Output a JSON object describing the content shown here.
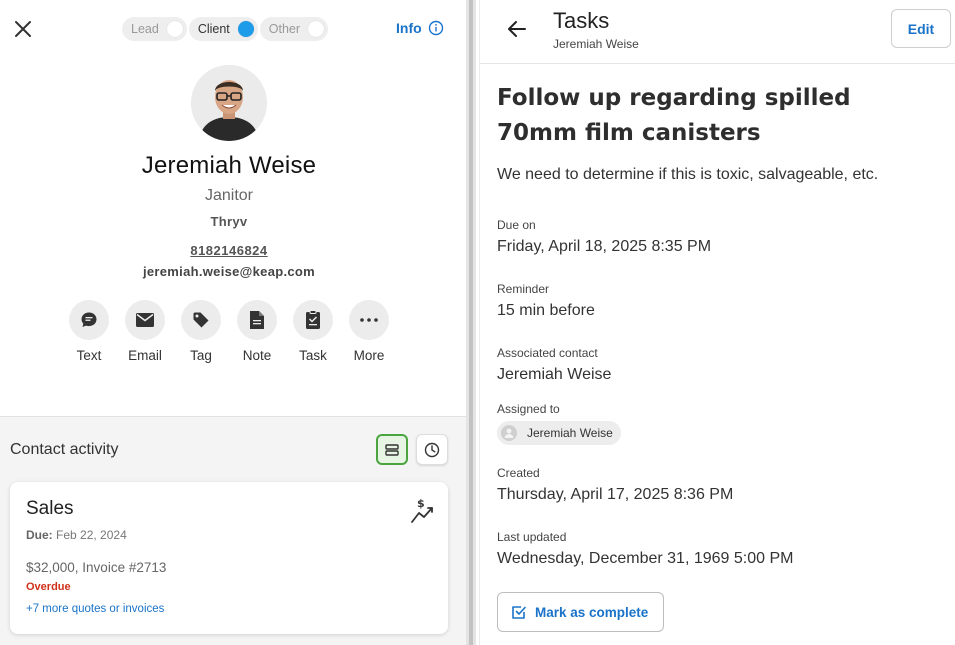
{
  "contact": {
    "stages": [
      {
        "label": "Lead",
        "active": false
      },
      {
        "label": "Client",
        "active": true
      },
      {
        "label": "Other",
        "active": false
      }
    ],
    "info_label": "Info",
    "name": "Jeremiah Weise",
    "job_title": "Janitor",
    "company": "Thryv",
    "phone": "8182146824",
    "email": "jeremiah.weise@keap.com",
    "actions": [
      {
        "label": "Text",
        "icon": "chat-icon"
      },
      {
        "label": "Email",
        "icon": "envelope-icon"
      },
      {
        "label": "Tag",
        "icon": "tag-icon"
      },
      {
        "label": "Note",
        "icon": "note-icon"
      },
      {
        "label": "Task",
        "icon": "task-icon"
      },
      {
        "label": "More",
        "icon": "more-icon"
      }
    ]
  },
  "activity": {
    "title": "Contact activity",
    "card": {
      "title": "Sales",
      "due_label": "Due:",
      "due_date": "Feb 22, 2024",
      "amount": "$32,000, Invoice #2713",
      "status": "Overdue",
      "more_link": "+7 more quotes or invoices"
    }
  },
  "task_panel": {
    "header_title": "Tasks",
    "header_subtitle": "Jeremiah Weise",
    "edit_label": "Edit",
    "task_title": "Follow up regarding spilled 70mm film canisters",
    "description": "We need to determine if this is toxic, salvageable, etc.",
    "fields": {
      "due_label": "Due on",
      "due_value": "Friday, April 18, 2025 8:35 PM",
      "reminder_label": "Reminder",
      "reminder_value": "15 min before",
      "contact_label": "Associated contact",
      "contact_value": "Jeremiah Weise",
      "assigned_label": "Assigned to",
      "assigned_value": "Jeremiah Weise",
      "created_label": "Created",
      "created_value": "Thursday, April 17, 2025 8:36 PM",
      "updated_label": "Last updated",
      "updated_value": "Wednesday, December 31, 1969 5:00 PM"
    },
    "complete_label": "Mark as complete"
  },
  "colors": {
    "accent_blue": "#1a73c9",
    "toggle_blue": "#1e9be9",
    "overdue_red": "#d0301a",
    "active_view_green": "#4aa53f"
  }
}
